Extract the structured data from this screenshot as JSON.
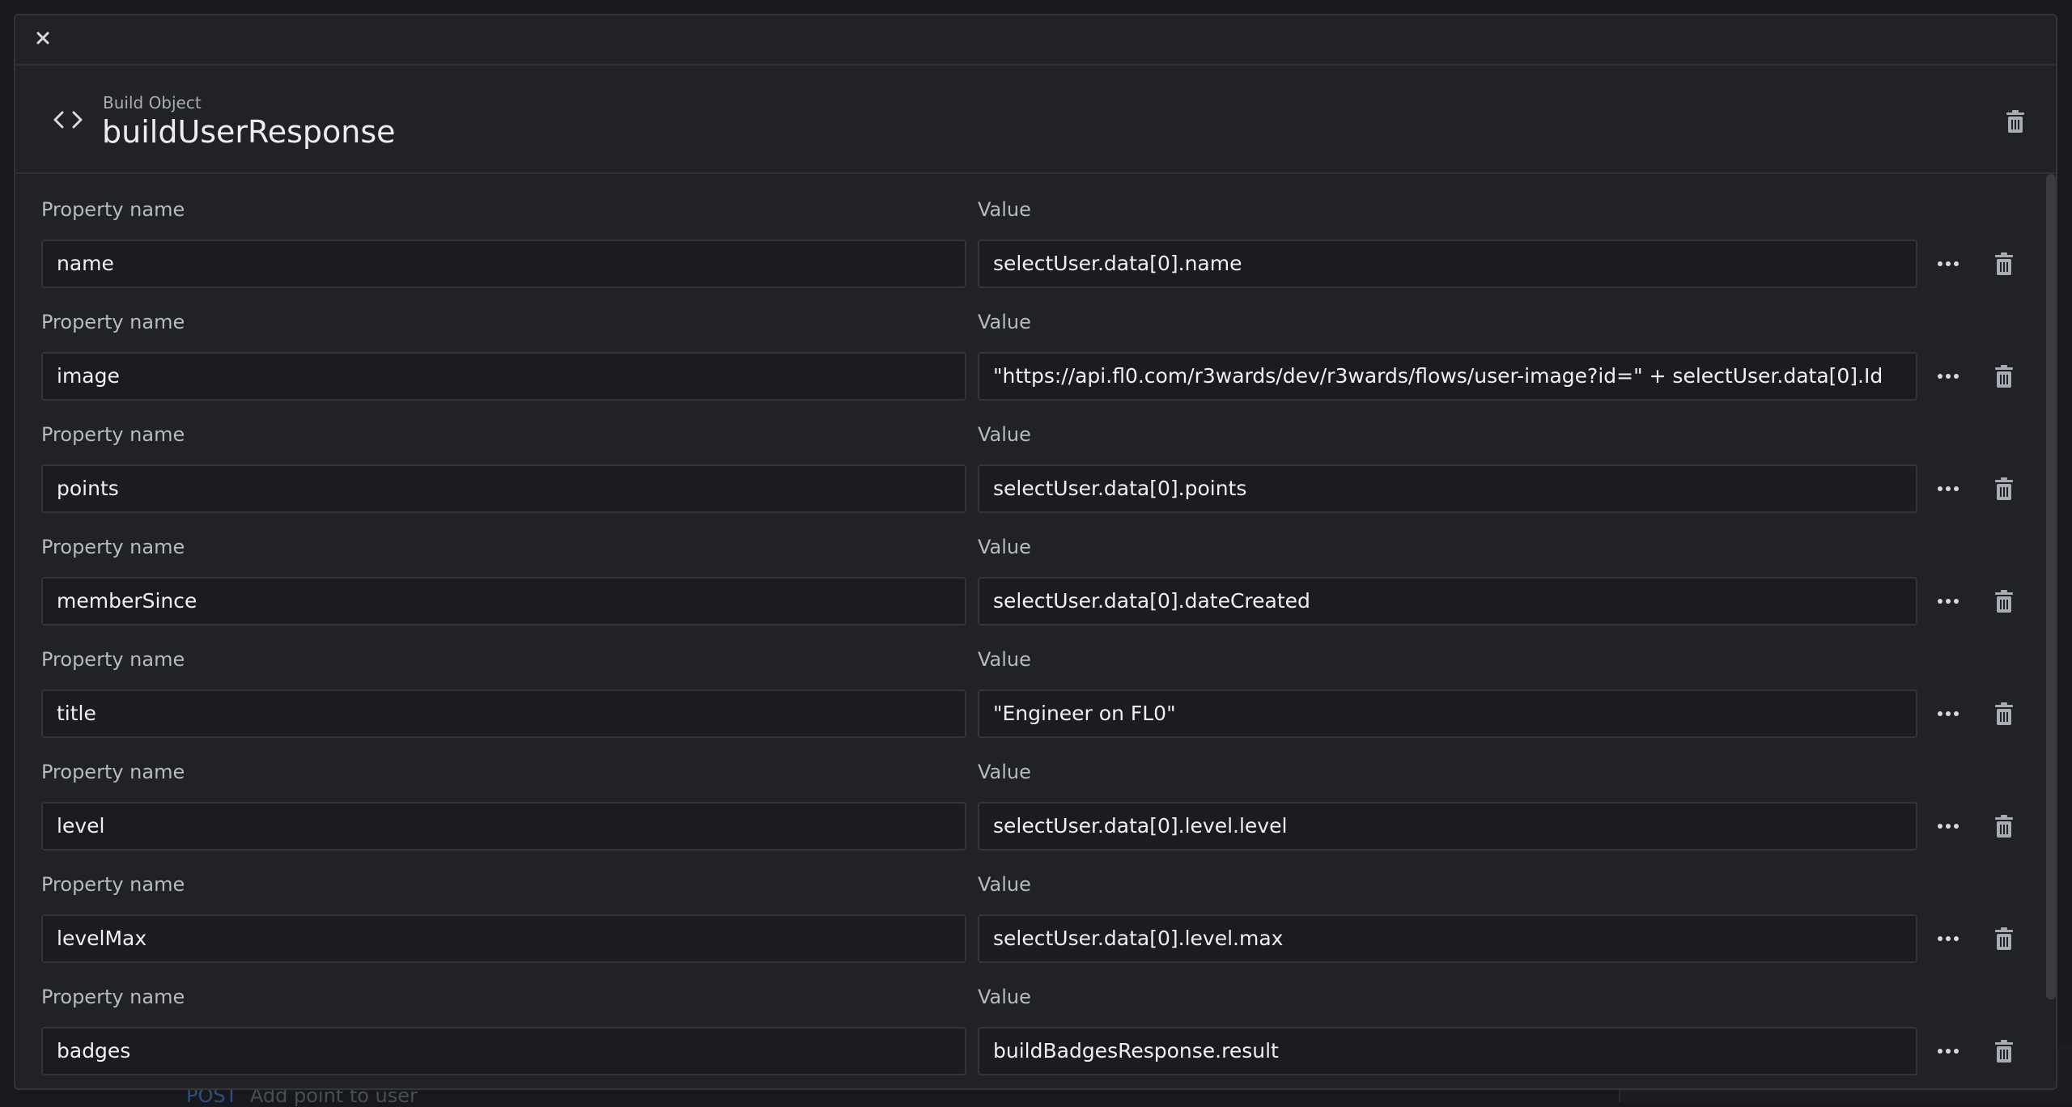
{
  "dialog": {
    "close_label": "×"
  },
  "header": {
    "subtitle": "Build Object",
    "title": "buildUserResponse"
  },
  "labels": {
    "property_name": "Property name",
    "value": "Value"
  },
  "properties": [
    {
      "name": "name",
      "value": "selectUser.data[0].name"
    },
    {
      "name": "image",
      "value": "\"https://api.fl0.com/r3wards/dev/r3wards/flows/user-image?id=\" + selectUser.data[0].Id"
    },
    {
      "name": "points",
      "value": "selectUser.data[0].points"
    },
    {
      "name": "memberSince",
      "value": "selectUser.data[0].dateCreated"
    },
    {
      "name": "title",
      "value": "\"Engineer on FL0\""
    },
    {
      "name": "level",
      "value": "selectUser.data[0].level.level"
    },
    {
      "name": "levelMax",
      "value": "selectUser.data[0].level.max"
    },
    {
      "name": "badges",
      "value": "buildBadgesResponse.result"
    }
  ],
  "background": {
    "method": "POST",
    "flow_label": "Add point to user"
  },
  "colors": {
    "modal_bg": "#212226",
    "field_bg": "#1b1c20",
    "border": "#33353b",
    "text": "#f0f1f4",
    "muted": "#b7bac2"
  }
}
